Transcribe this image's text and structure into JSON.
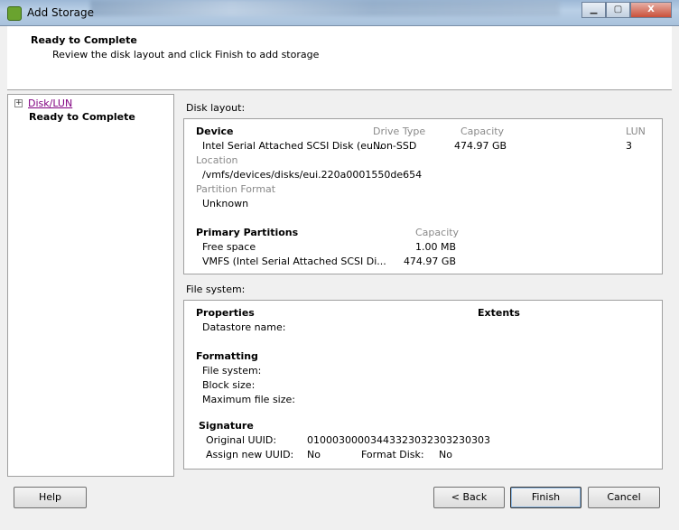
{
  "window": {
    "title": "Add Storage",
    "minimize": "▁",
    "maximize": "▢",
    "close": "X"
  },
  "header": {
    "title": "Ready to Complete",
    "subtitle": "Review the disk layout and click Finish to add storage"
  },
  "nav": {
    "items": [
      {
        "label": "Disk/LUN"
      },
      {
        "label": "Ready to Complete"
      }
    ],
    "expand": "+"
  },
  "disk_layout": {
    "label": "Disk layout:",
    "device_header": "Device",
    "drive_type_header": "Drive Type",
    "capacity_header": "Capacity",
    "lun_header": "LUN",
    "device": "Intel Serial Attached SCSI Disk (eu...",
    "drive_type": "Non-SSD",
    "capacity": "474.97 GB",
    "lun": "3",
    "location_label": "Location",
    "location": "/vmfs/devices/disks/eui.220a0001550de654",
    "partition_format_label": "Partition Format",
    "partition_format": "Unknown",
    "partitions_header": "Primary Partitions",
    "partitions_capacity_header": "Capacity",
    "partitions": [
      {
        "name": "Free space",
        "capacity": "1.00 MB"
      },
      {
        "name": "VMFS (Intel Serial Attached SCSI Di...",
        "capacity": "474.97 GB"
      }
    ]
  },
  "file_system": {
    "label": "File system:",
    "properties": "Properties",
    "extents": "Extents",
    "datastore_name": "Datastore name:",
    "formatting": "Formatting",
    "file_system": "File system:",
    "block_size": "Block size:",
    "max_file_size": "Maximum file size:",
    "signature": "Signature",
    "original_uuid_label": "Original UUID:",
    "original_uuid": "01000300003443323032303230303",
    "assign_uuid_label": "Assign new UUID:",
    "assign_uuid": "No",
    "format_disk_label": "Format Disk:",
    "format_disk": "No"
  },
  "buttons": {
    "help": "Help",
    "back": "< Back",
    "finish": "Finish",
    "cancel": "Cancel"
  }
}
